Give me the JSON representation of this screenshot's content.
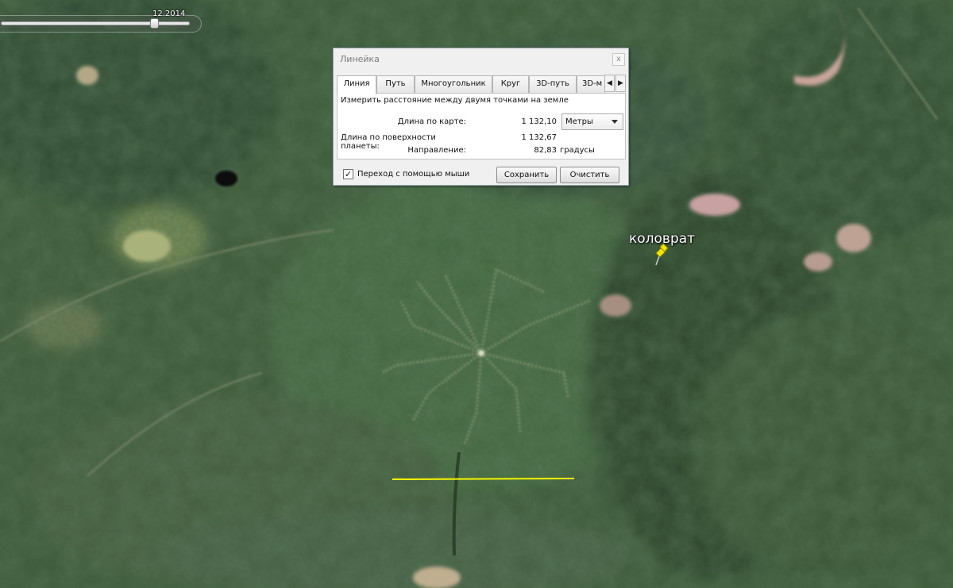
{
  "timeline": {
    "date_label": "12.2014",
    "position": 0.83
  },
  "placemark": {
    "label": "коловрат",
    "pin_color": "#f2e600"
  },
  "measure_line_color": "#f5f500",
  "ruler_dialog": {
    "title": "Линейка",
    "close_glyph": "x",
    "tabs": [
      "Линия",
      "Путь",
      "Многоугольник",
      "Круг",
      "3D-путь",
      "3D-м"
    ],
    "active_tab": "Линия",
    "description": "Измерить расстояние между двумя точками на земле",
    "map_length": {
      "label": "Длина по карте:",
      "value": "1 132,10"
    },
    "units": {
      "selected": "Метры"
    },
    "ground_length": {
      "label": "Длина по поверхности планеты:",
      "value": "1 132,67"
    },
    "heading": {
      "label": "Направление:",
      "value": "82,83",
      "unit": "градусы"
    },
    "mouse_navigation": {
      "label": "Переход с помощью мыши",
      "checked": true
    },
    "save_label": "Сохранить",
    "clear_label": "Очистить",
    "icons": {
      "prev": "chevron-left-icon",
      "next": "chevron-right-icon"
    }
  }
}
